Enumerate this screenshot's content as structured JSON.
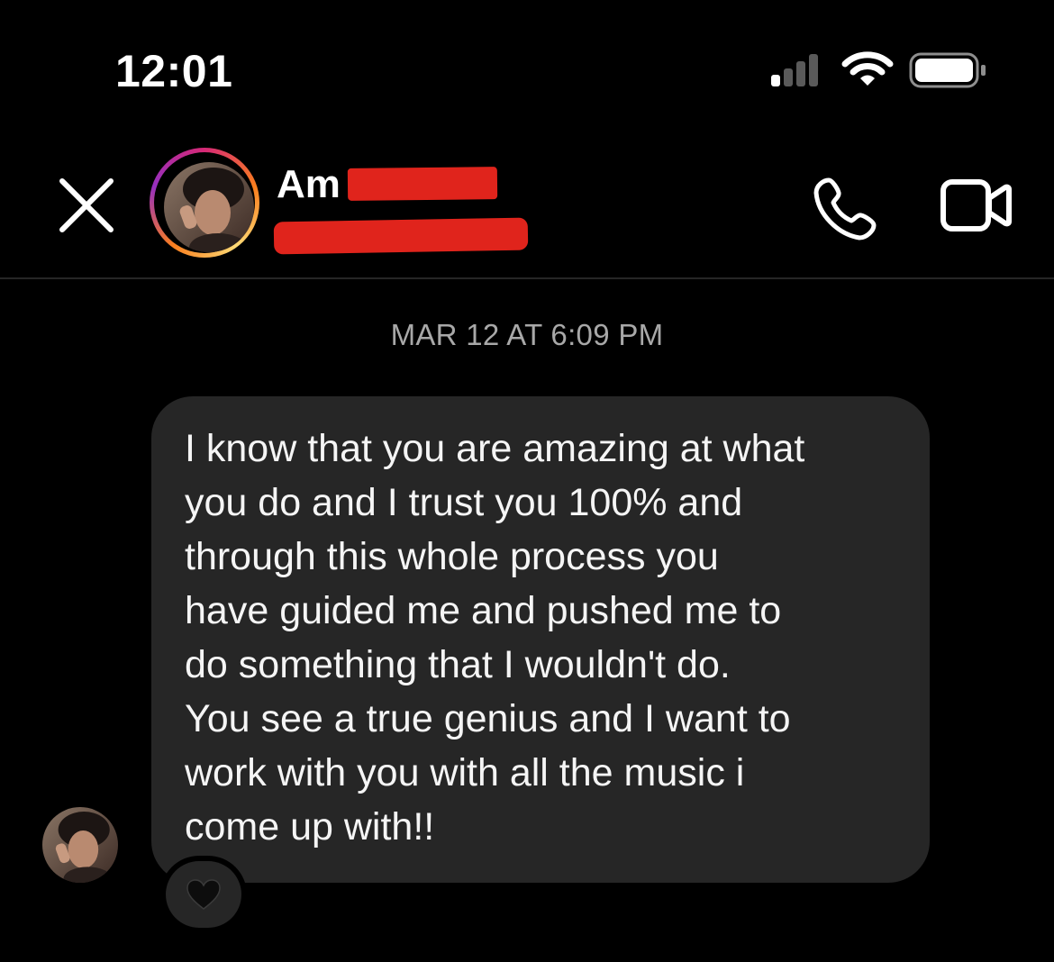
{
  "status_bar": {
    "time": "12:01",
    "icons": [
      "signal-icon",
      "wifi-icon",
      "battery-icon"
    ]
  },
  "header": {
    "contact_name_visible": "Am",
    "icons": [
      "close-icon",
      "phone-icon",
      "video-camera-icon"
    ]
  },
  "thread": {
    "timestamp": "MAR 12 AT 6:09 PM",
    "message": {
      "text": "I know that you are amazing at what\nyou do and I trust you 100% and\nthrough this whole process you\nhave guided me and pushed me to\ndo something that I wouldn't do.\nYou see a true genius and I want to\nwork with you with all the music i\ncome up with!!",
      "reaction": "🖤"
    }
  },
  "colors": {
    "background": "#000000",
    "bubble": "#262626",
    "timestamp_text": "#a8a8a8",
    "redaction": "#e0241c",
    "divider": "#262626"
  }
}
